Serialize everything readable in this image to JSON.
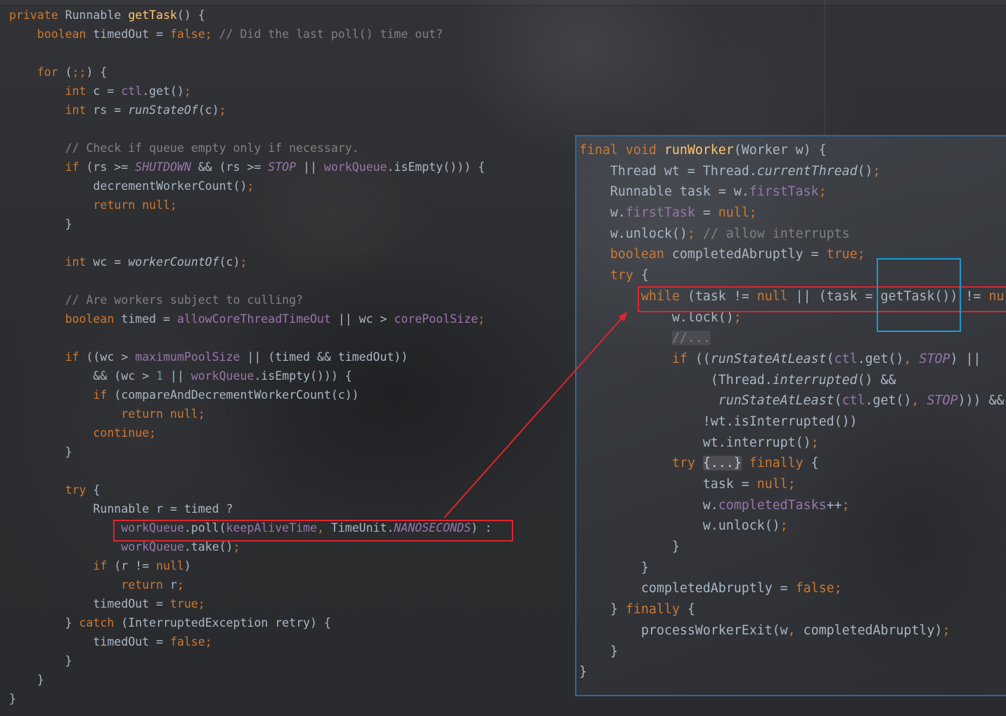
{
  "colors": {
    "keyword": "#cc7832",
    "text": "#a9b7c6",
    "comment": "#808080",
    "method": "#ffc66d",
    "field": "#9876aa",
    "number": "#6897bb",
    "highlight_red": "#e0242c",
    "highlight_blue": "#1b9ad6",
    "panel_border": "#2c6aa3"
  },
  "left_code": {
    "lines": [
      [
        {
          "kw": "private"
        },
        {
          "p": " Runnable "
        },
        {
          "m": "getTask"
        },
        {
          "p": "() {"
        }
      ],
      [
        {
          "kw": "    boolean"
        },
        {
          "p": " timedOut = "
        },
        {
          "kw": "false;"
        },
        {
          "c": " // Did the last poll() time out?"
        }
      ],
      [],
      [
        {
          "kw": "    for"
        },
        {
          "p": " ("
        },
        {
          "kw": ";;"
        },
        {
          "p": ") {"
        }
      ],
      [
        {
          "kw": "        int"
        },
        {
          "p": " c = "
        },
        {
          "f": "ctl"
        },
        {
          "p": ".get()"
        },
        {
          "kw": ";"
        }
      ],
      [
        {
          "kw": "        int"
        },
        {
          "p": " rs = "
        },
        {
          "i": "runStateOf"
        },
        {
          "p": "(c)"
        },
        {
          "kw": ";"
        }
      ],
      [],
      [
        {
          "c": "        // Check if queue empty only if necessary."
        }
      ],
      [
        {
          "kw": "        if"
        },
        {
          "p": " (rs >= "
        },
        {
          "fi": "SHUTDOWN"
        },
        {
          "p": " && (rs >= "
        },
        {
          "fi": "STOP"
        },
        {
          "p": " || "
        },
        {
          "f": "workQueue"
        },
        {
          "p": ".isEmpty())) {"
        }
      ],
      [
        {
          "p": "            decrementWorkerCount()"
        },
        {
          "kw": ";"
        }
      ],
      [
        {
          "kw": "            return null;"
        }
      ],
      [
        {
          "p": "        }"
        }
      ],
      [],
      [
        {
          "kw": "        int"
        },
        {
          "p": " wc = "
        },
        {
          "i": "workerCountOf"
        },
        {
          "p": "(c)"
        },
        {
          "kw": ";"
        }
      ],
      [],
      [
        {
          "c": "        // Are workers subject to culling?"
        }
      ],
      [
        {
          "kw": "        boolean"
        },
        {
          "p": " timed = "
        },
        {
          "f": "allowCoreThreadTimeOut"
        },
        {
          "p": " || wc > "
        },
        {
          "f": "corePoolSize"
        },
        {
          "kw": ";"
        }
      ],
      [],
      [
        {
          "kw": "        if"
        },
        {
          "p": " ((wc > "
        },
        {
          "f": "maximumPoolSize"
        },
        {
          "p": " || (timed && timedOut))"
        }
      ],
      [
        {
          "p": "            && (wc > "
        },
        {
          "n": "1"
        },
        {
          "p": " || "
        },
        {
          "f": "workQueue"
        },
        {
          "p": ".isEmpty())) {"
        }
      ],
      [
        {
          "kw": "            if"
        },
        {
          "p": " (compareAndDecrementWorkerCount(c))"
        }
      ],
      [
        {
          "kw": "                return null;"
        }
      ],
      [
        {
          "kw": "            continue;"
        }
      ],
      [
        {
          "p": "        }"
        }
      ],
      [],
      [
        {
          "kw": "        try"
        },
        {
          "p": " {"
        }
      ],
      [
        {
          "p": "            Runnable r = timed ?"
        }
      ],
      [
        {
          "f": "                workQueue"
        },
        {
          "p": ".poll("
        },
        {
          "f": "keepAliveTime"
        },
        {
          "kw": ","
        },
        {
          "p": " TimeUnit."
        },
        {
          "fi": "NANOSECONDS"
        },
        {
          "p": ") :"
        }
      ],
      [
        {
          "f": "                workQueue"
        },
        {
          "p": ".take()"
        },
        {
          "kw": ";"
        }
      ],
      [
        {
          "kw": "            if"
        },
        {
          "p": " (r != "
        },
        {
          "kw": "null"
        },
        {
          "p": ")"
        }
      ],
      [
        {
          "kw": "                return"
        },
        {
          "p": " r"
        },
        {
          "kw": ";"
        }
      ],
      [
        {
          "p": "            timedOut = "
        },
        {
          "kw": "true;"
        }
      ],
      [
        {
          "p": "        } "
        },
        {
          "kw": "catch"
        },
        {
          "p": " (InterruptedException retry) {"
        }
      ],
      [
        {
          "p": "            timedOut = "
        },
        {
          "kw": "false;"
        }
      ],
      [
        {
          "p": "        }"
        }
      ],
      [
        {
          "p": "    }"
        }
      ],
      [
        {
          "p": "}"
        }
      ]
    ]
  },
  "right_code": {
    "lines": [
      [
        {
          "kw": "final void"
        },
        {
          "p": " "
        },
        {
          "m": "runWorker"
        },
        {
          "p": "(Worker w) {"
        }
      ],
      [
        {
          "p": "    Thread wt = Thread."
        },
        {
          "i": "currentThread"
        },
        {
          "p": "()"
        },
        {
          "kw": ";"
        }
      ],
      [
        {
          "p": "    Runnable task = w."
        },
        {
          "f": "firstTask"
        },
        {
          "kw": ";"
        }
      ],
      [
        {
          "p": "    w."
        },
        {
          "f": "firstTask"
        },
        {
          "p": " = "
        },
        {
          "kw": "null;"
        }
      ],
      [
        {
          "p": "    w.unlock()"
        },
        {
          "kw": ";"
        },
        {
          "c": " // allow interrupts"
        }
      ],
      [
        {
          "kw": "    boolean"
        },
        {
          "p": " completedAbruptly = "
        },
        {
          "kw": "true;"
        }
      ],
      [
        {
          "kw": "    try"
        },
        {
          "p": " {"
        }
      ],
      [
        {
          "kw": "        while"
        },
        {
          "p": " (task != "
        },
        {
          "kw": "null"
        },
        {
          "p": " || (task = getTask()) != "
        },
        {
          "kw": "nu"
        }
      ],
      [
        {
          "p": "            w.lock()"
        },
        {
          "kw": ";"
        }
      ],
      [
        {
          "p": "            "
        },
        {
          "fc": "//..."
        }
      ],
      [
        {
          "kw": "            if"
        },
        {
          "p": " (("
        },
        {
          "i": "runStateAtLeast"
        },
        {
          "p": "("
        },
        {
          "f": "ctl"
        },
        {
          "p": ".get()"
        },
        {
          "kw": ","
        },
        {
          "p": " "
        },
        {
          "fi": "STOP"
        },
        {
          "p": ") ||"
        }
      ],
      [
        {
          "p": "                 (Thread."
        },
        {
          "i": "interrupted"
        },
        {
          "p": "() &&"
        }
      ],
      [
        {
          "i": "                  runStateAtLeast"
        },
        {
          "p": "("
        },
        {
          "f": "ctl"
        },
        {
          "p": ".get()"
        },
        {
          "kw": ","
        },
        {
          "p": " "
        },
        {
          "fi": "STOP"
        },
        {
          "p": "))) &&"
        }
      ],
      [
        {
          "p": "                !wt.isInterrupted())"
        }
      ],
      [
        {
          "p": "                wt.interrupt()"
        },
        {
          "kw": ";"
        }
      ],
      [
        {
          "kw": "            try"
        },
        {
          "p": " "
        },
        {
          "fd": "{...}"
        },
        {
          "p": " "
        },
        {
          "kw": "finally"
        },
        {
          "p": " {"
        }
      ],
      [
        {
          "p": "                task = "
        },
        {
          "kw": "null;"
        }
      ],
      [
        {
          "p": "                w."
        },
        {
          "f": "completedTasks"
        },
        {
          "p": "++"
        },
        {
          "kw": ";"
        }
      ],
      [
        {
          "p": "                w.unlock()"
        },
        {
          "kw": ";"
        }
      ],
      [
        {
          "p": "            }"
        }
      ],
      [
        {
          "p": "        }"
        }
      ],
      [
        {
          "p": "        completedAbruptly = "
        },
        {
          "kw": "false;"
        }
      ],
      [
        {
          "p": "    } "
        },
        {
          "kw": "finally"
        },
        {
          "p": " {"
        }
      ],
      [
        {
          "p": "        processWorkerExit(w"
        },
        {
          "kw": ","
        },
        {
          "p": " completedAbruptly)"
        },
        {
          "kw": ";"
        }
      ],
      [
        {
          "p": "    }"
        }
      ],
      [
        {
          "p": "}"
        }
      ]
    ]
  }
}
